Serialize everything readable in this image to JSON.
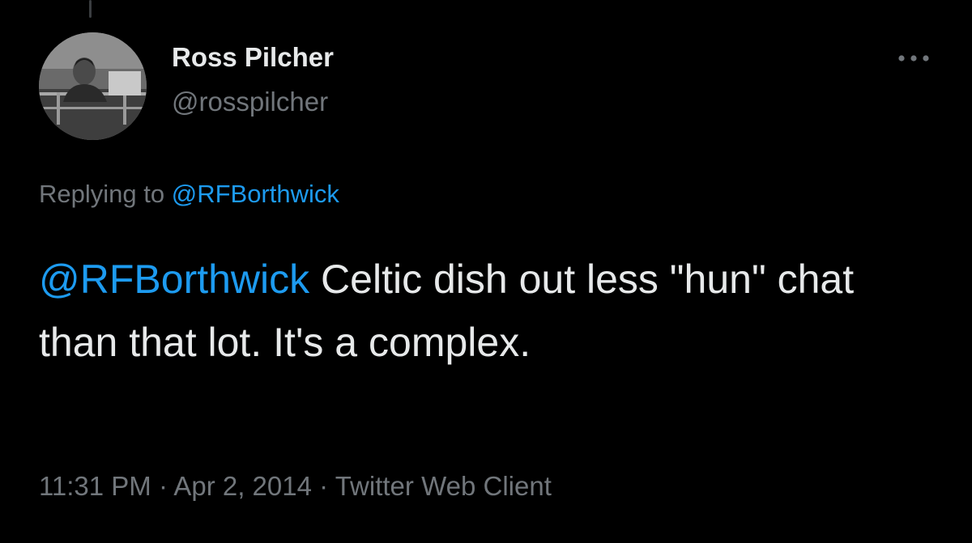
{
  "colors": {
    "background": "#000000",
    "primary_text": "#e7e9ea",
    "secondary_text": "#71767b",
    "link": "#1d9bf0"
  },
  "tweet": {
    "author": {
      "display_name": "Ross Pilcher",
      "handle": "@rosspilcher",
      "avatar_icon": "user-photo-avatar"
    },
    "more_icon": "more-dots-icon",
    "replying": {
      "prefix": "Replying to",
      "mention": "@RFBorthwick"
    },
    "body": {
      "mention": "@RFBorthwick",
      "text": "Celtic dish out less \"hun\" chat than that lot. It's a complex."
    },
    "meta": {
      "time": "11:31 PM",
      "separator": "·",
      "date": "Apr 2, 2014",
      "source": "Twitter Web Client"
    }
  }
}
